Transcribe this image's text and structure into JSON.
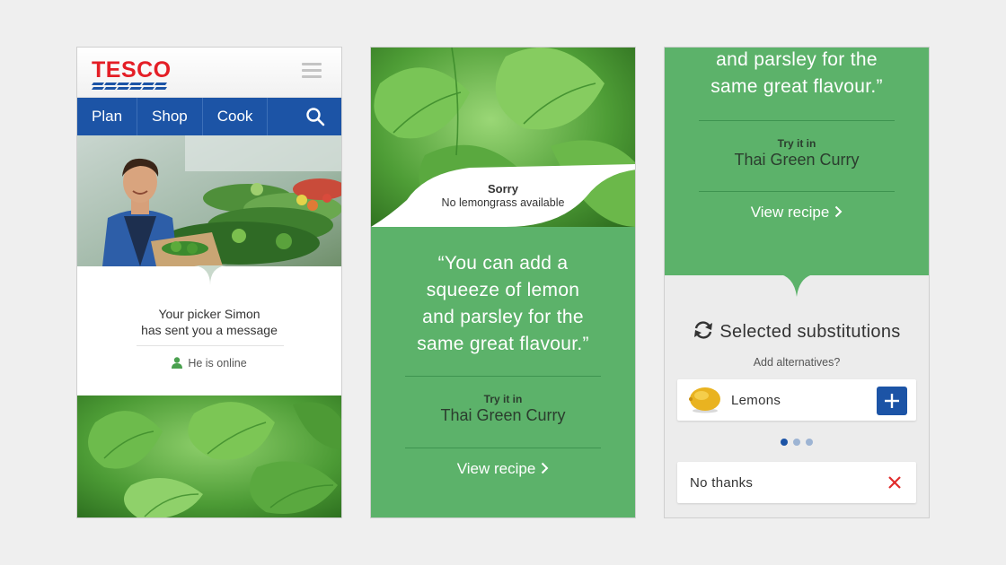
{
  "phone1": {
    "logo": "TESCO",
    "nav": [
      "Plan",
      "Shop",
      "Cook"
    ],
    "message_line1": "Your picker Simon",
    "message_line2": "has sent you a message",
    "online_status": "He is online"
  },
  "phone2": {
    "sorry_title": "Sorry",
    "sorry_subtitle": "No lemongrass available",
    "quote_line1": "“You can add a",
    "quote_line2": "squeeze of lemon",
    "quote_line3": "and parsley for the",
    "quote_line4": "same great flavour.”",
    "try_label": "Try it in",
    "recipe_name": "Thai Green Curry",
    "view_recipe": "View recipe"
  },
  "phone3": {
    "quote_line1": "and parsley for the",
    "quote_line2": "same great flavour.”",
    "try_label": "Try it in",
    "recipe_name": "Thai Green Curry",
    "view_recipe": "View recipe",
    "subs_title": "Selected substitutions",
    "subs_hint": "Add alternatives?",
    "item_label": "Lemons",
    "no_thanks": "No thanks",
    "carousel": {
      "pages": 3,
      "current": 1
    }
  },
  "colors": {
    "tesco_red": "#e41e26",
    "tesco_blue": "#1c54a6",
    "green": "#5cb26a",
    "remove_red": "#e02b2b"
  },
  "icons": [
    "hamburger-icon",
    "search-icon",
    "person-icon",
    "chevron-right-icon",
    "swap-icon",
    "plus-icon",
    "close-icon",
    "lemon-icon"
  ]
}
